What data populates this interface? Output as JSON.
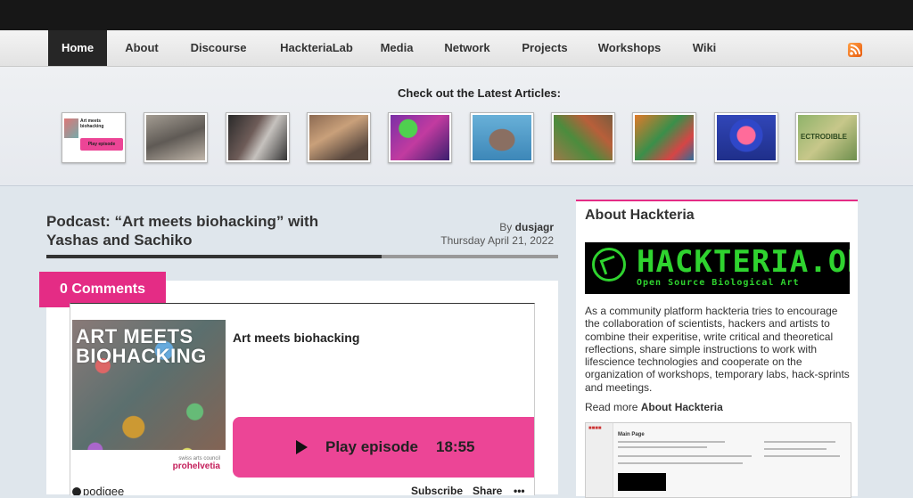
{
  "nav": {
    "items": [
      {
        "label": "Home",
        "active": true
      },
      {
        "label": "About"
      },
      {
        "label": "Discourse"
      },
      {
        "label": "HackteriaLab"
      },
      {
        "label": "Media"
      },
      {
        "label": "Network"
      },
      {
        "label": "Projects"
      },
      {
        "label": "Workshops"
      },
      {
        "label": "Wiki"
      }
    ],
    "rss_icon": "rss-icon"
  },
  "latest": {
    "title": "Check out the Latest Articles:",
    "thumbs": [
      {
        "caption": "Art meets biohacking",
        "button": "Play episode"
      },
      {},
      {},
      {},
      {},
      {},
      {},
      {},
      {},
      {
        "caption": "ECTRODIBLE"
      }
    ]
  },
  "post": {
    "title": "Podcast: “Art meets biohacking” with Yashas and Sachiko",
    "by_label": "By",
    "author": "dusjagr",
    "date": "Thursday April 21, 2022",
    "comments": "0 Comments"
  },
  "embed": {
    "cover_text": "ART MEETS BIOHACKING",
    "cover_council": "swiss arts council",
    "cover_brand": "prohelvetia",
    "episode_title": "Art meets biohacking",
    "play_label": "Play episode",
    "duration": "18:55",
    "logo": "podigee",
    "subscribe": "Subscribe",
    "share": "Share",
    "more": "•••"
  },
  "sidebar": {
    "title": "About Hackteria",
    "logo_main": "HACKTERIA.ORG",
    "logo_sub": "Open Source Biological Art",
    "text": "As a community platform hackteria tries to encourage the collaboration of scientists, hackers and artists to combine their experitise, write critical and theoretical reflections, share simple instructions to work with lifescience technologies and cooperate on the organization of workshops, temporary labs, hack-sprints and meetings.",
    "read_more_prefix": "Read more",
    "read_more_link": "About Hackteria",
    "wiki_heading": "Main Page"
  },
  "colors": {
    "accent": "#e42c85",
    "play_button": "#ec4596",
    "logo_green": "#2fd32f",
    "nav_active": "#262626"
  }
}
